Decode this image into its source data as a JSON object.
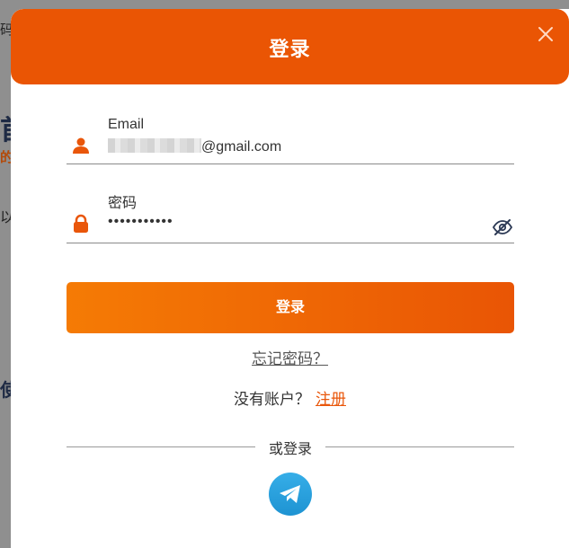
{
  "background": {
    "frag1": "码",
    "frag2": "首",
    "frag3": "的",
    "frag4": "以在",
    "frag5": "使用"
  },
  "modal": {
    "title": "登录",
    "close_icon": "close-icon",
    "email_label": "Email",
    "email_value_suffix": "@gmail.com",
    "password_label": "密码",
    "password_value": "•••••••••••",
    "login_button": "登录",
    "forgot_link": "忘记密码？",
    "no_account_text": "没有账户？",
    "signup_link": "注册",
    "or_login_text": "或登录",
    "accent_color": "#ea5504",
    "icons": {
      "email": "user-icon",
      "password": "lock-icon",
      "visibility": "eye-off-icon",
      "social": "telegram-icon"
    }
  }
}
